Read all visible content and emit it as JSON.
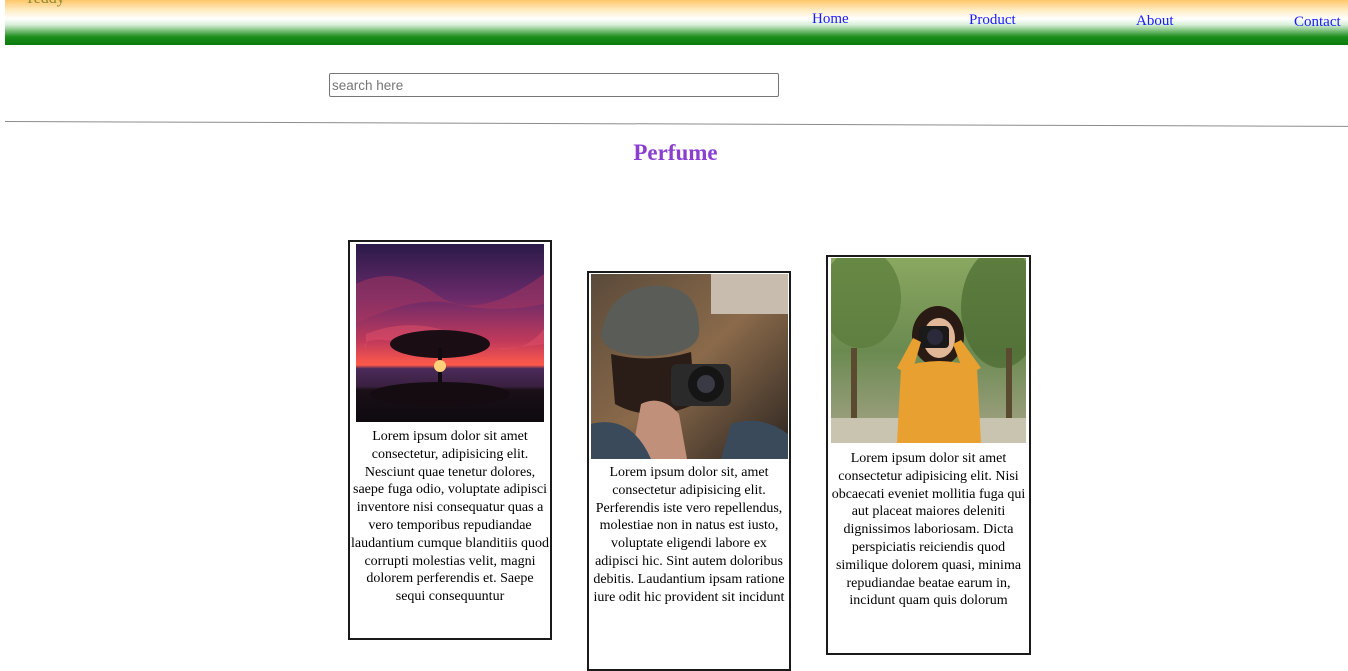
{
  "nav": {
    "logo": "Teddy",
    "links": [
      "Home",
      "Product",
      "About",
      "Contact"
    ]
  },
  "search": {
    "placeholder": "search here",
    "value": ""
  },
  "page": {
    "title": "Perfume"
  },
  "cards": [
    {
      "image": "tree-sunset-image",
      "text": "Lorem ipsum dolor sit amet consectetur, adipisicing elit. Nesciunt quae tenetur dolores, saepe fuga odio, voluptate adipisci inventore nisi consequatur quas a vero temporibus repudiandae laudantium cumque blanditiis quod corrupti molestias velit, magni dolorem perferendis et. Saepe sequi consequuntur"
    },
    {
      "image": "photographer-beanie-image",
      "text": "Lorem ipsum dolor sit, amet consectetur adipisicing elit. Perferendis iste vero repellendus, molestiae non in natus est iusto, voluptate eligendi labore ex adipisci hic. Sint autem doloribus debitis. Laudantium ipsam ratione iure odit hic provident sit incidunt"
    },
    {
      "image": "photographer-yellow-sweater-image",
      "text": "Lorem ipsum dolor sit amet consectetur adipisicing elit. Nisi obcaecati eveniet mollitia fuga qui aut placeat maiores deleniti dignissimos laboriosam. Dicta perspiciatis reiciendis quod similique dolorem quasi, minima repudiandae beatae earum in, incidunt quam quis dolorum"
    }
  ]
}
